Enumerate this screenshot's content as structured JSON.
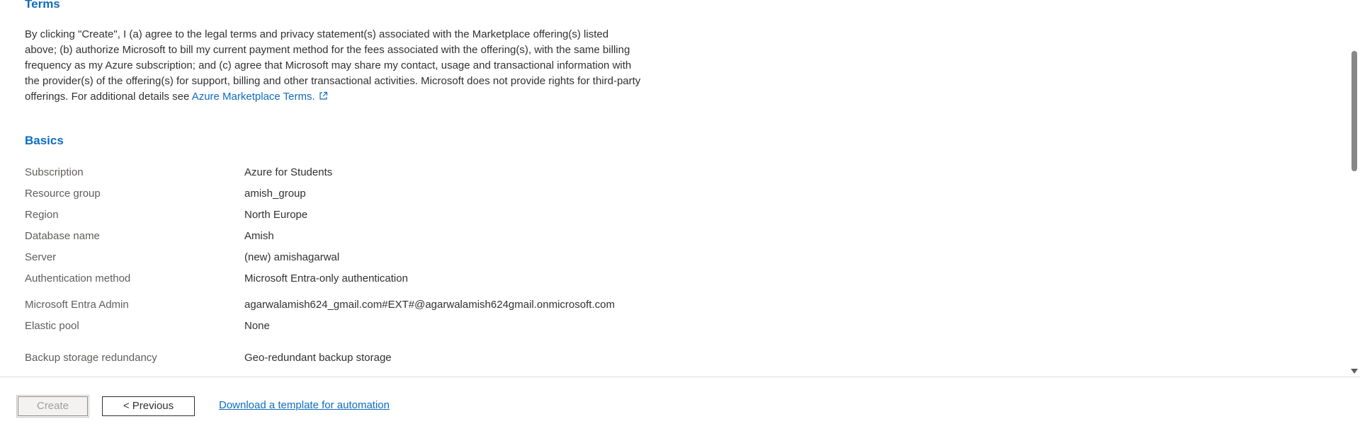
{
  "terms": {
    "title": "Terms",
    "text": "By clicking \"Create\", I (a) agree to the legal terms and privacy statement(s) associated with the Marketplace offering(s) listed above; (b) authorize Microsoft to bill my current payment method for the fees associated with the offering(s), with the same billing frequency as my Azure subscription; and (c) agree that Microsoft may share my contact, usage and transactional information with the provider(s) of the offering(s) for support, billing and other transactional activities. Microsoft does not provide rights for third-party offerings. For additional details see ",
    "link_label": "Azure Marketplace Terms."
  },
  "basics": {
    "title": "Basics",
    "rows": [
      {
        "label": "Subscription",
        "value": "Azure for Students"
      },
      {
        "label": "Resource group",
        "value": "amish_group"
      },
      {
        "label": "Region",
        "value": "North Europe"
      },
      {
        "label": "Database name",
        "value": "Amish"
      },
      {
        "label": "Server",
        "value": "(new) amishagarwal"
      },
      {
        "label": "Authentication method",
        "value": "Microsoft Entra-only authentication"
      },
      {
        "label": "Microsoft Entra Admin",
        "value": "agarwalamish624_gmail.com#EXT#@agarwalamish624gmail.onmicrosoft.com"
      },
      {
        "label": "Elastic pool",
        "value": "None"
      },
      {
        "label": "Backup storage redundancy",
        "value": "Geo-redundant backup storage"
      }
    ]
  },
  "footer": {
    "create_label": "Create",
    "previous_label": "< Previous",
    "download_link": "Download a template for automation"
  },
  "icons": {
    "external_link": "external-link-icon",
    "scroll_down": "chevron-down-icon"
  },
  "colors": {
    "accent": "#0f6cbd",
    "text": "#323130",
    "label": "#605e5c"
  }
}
